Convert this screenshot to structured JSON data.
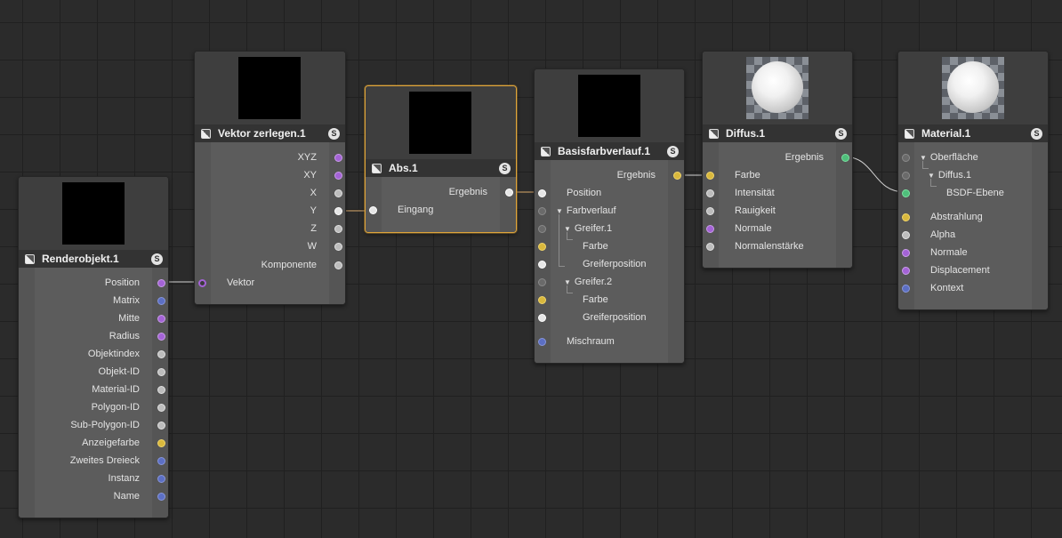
{
  "colors": {
    "vector_port": "#a463d6",
    "matrix_port": "#5c6fc4",
    "float_port": "#bdbdbd",
    "color_port": "#d9b83d",
    "material_port": "#4fbf7b",
    "selected_border": "#e0a53a"
  },
  "icons": {
    "node_icon": "node-type-icon",
    "solo_button": "S"
  },
  "nodes": {
    "renderobjekt": {
      "title": "Renderobjekt.1",
      "outputs": [
        "Position",
        "Matrix",
        "Mitte",
        "Radius",
        "Objektindex",
        "Objekt-ID",
        "Material-ID",
        "Polygon-ID",
        "Sub-Polygon-ID",
        "Anzeigefarbe",
        "Zweites Dreieck",
        "Instanz",
        "Name"
      ]
    },
    "vektor": {
      "title": "Vektor zerlegen.1",
      "outputs": [
        "XYZ",
        "XY",
        "X",
        "Y",
        "Z",
        "W",
        "Komponente"
      ],
      "inputs": [
        "Vektor"
      ]
    },
    "abs": {
      "title": "Abs.1",
      "outputs": [
        "Ergebnis"
      ],
      "inputs": [
        "Eingang"
      ]
    },
    "basis": {
      "title": "Basisfarbverlauf.1",
      "outputs": [
        "Ergebnis"
      ],
      "inputs": [
        "Position",
        "Farbverlauf",
        "Greifer.1",
        "Farbe",
        "Greiferposition",
        "Greifer.2",
        "Farbe",
        "Greiferposition",
        "Mischraum"
      ]
    },
    "diffus": {
      "title": "Diffus.1",
      "outputs": [
        "Ergebnis"
      ],
      "inputs": [
        "Farbe",
        "Intensität",
        "Rauigkeit",
        "Normale",
        "Normalenstärke"
      ]
    },
    "material": {
      "title": "Material.1",
      "inputs": [
        "Oberfläche",
        "Diffus.1",
        "BSDF-Ebene",
        "Abstrahlung",
        "Alpha",
        "Normale",
        "Displacement",
        "Kontext"
      ]
    }
  }
}
